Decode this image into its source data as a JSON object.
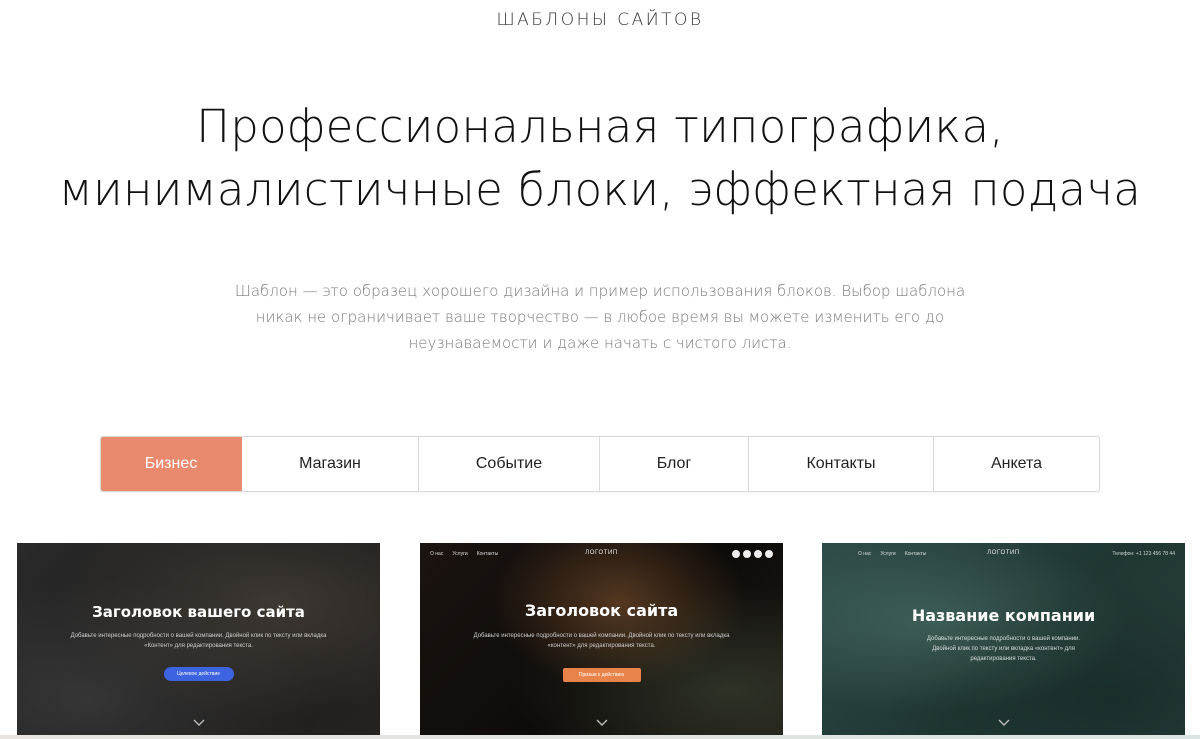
{
  "header": {
    "eyebrow": "ШАБЛОНЫ САЙТОВ",
    "headline_line1": "Профессиональная типографика,",
    "headline_line2": "минималистичные блоки, эффектная подача",
    "lead": "Шаблон — это образец хорошего дизайна и пример использования блоков. Выбор шаблона никак не ограничивает ваше творчество — в любое время вы можете изменить его до неузнаваемости и даже начать с чистого листа."
  },
  "tabs": [
    {
      "label": "Бизнес",
      "active": true
    },
    {
      "label": "Магазин",
      "active": false
    },
    {
      "label": "Событие",
      "active": false
    },
    {
      "label": "Блог",
      "active": false
    },
    {
      "label": "Контакты",
      "active": false
    },
    {
      "label": "Анкета",
      "active": false
    }
  ],
  "templates": [
    {
      "title": "Заголовок вашего сайта",
      "description": "Добавьте интересные подробности о вашей компании. Двойной клик по тексту или вкладка «Контент» для редактирования текста.",
      "button": "Целевое действие",
      "button_color": "#3d63e0"
    },
    {
      "nav": [
        "О нас",
        "Услуги",
        "Контакты"
      ],
      "logo": "ЛОГОТИП",
      "title": "Заголовок сайта",
      "description": "Добавьте интересные подробности о вашей компании. Двойной клик по тексту или вкладка «контент» для редактирования текста.",
      "button": "Призыв к действию",
      "button_color": "#e8844a"
    },
    {
      "nav": [
        "О нас",
        "Услуги",
        "Контакты"
      ],
      "logo": "ЛОГОТИП",
      "phone": "Телефон: +1 123 456 78 44",
      "title": "Название компании",
      "description": "Добавьте интересные подробности о вашей компании. Двойной клик по тексту или вкладка «контент» для редактирования текста."
    }
  ],
  "colors": {
    "accent": "#e98a6e"
  }
}
